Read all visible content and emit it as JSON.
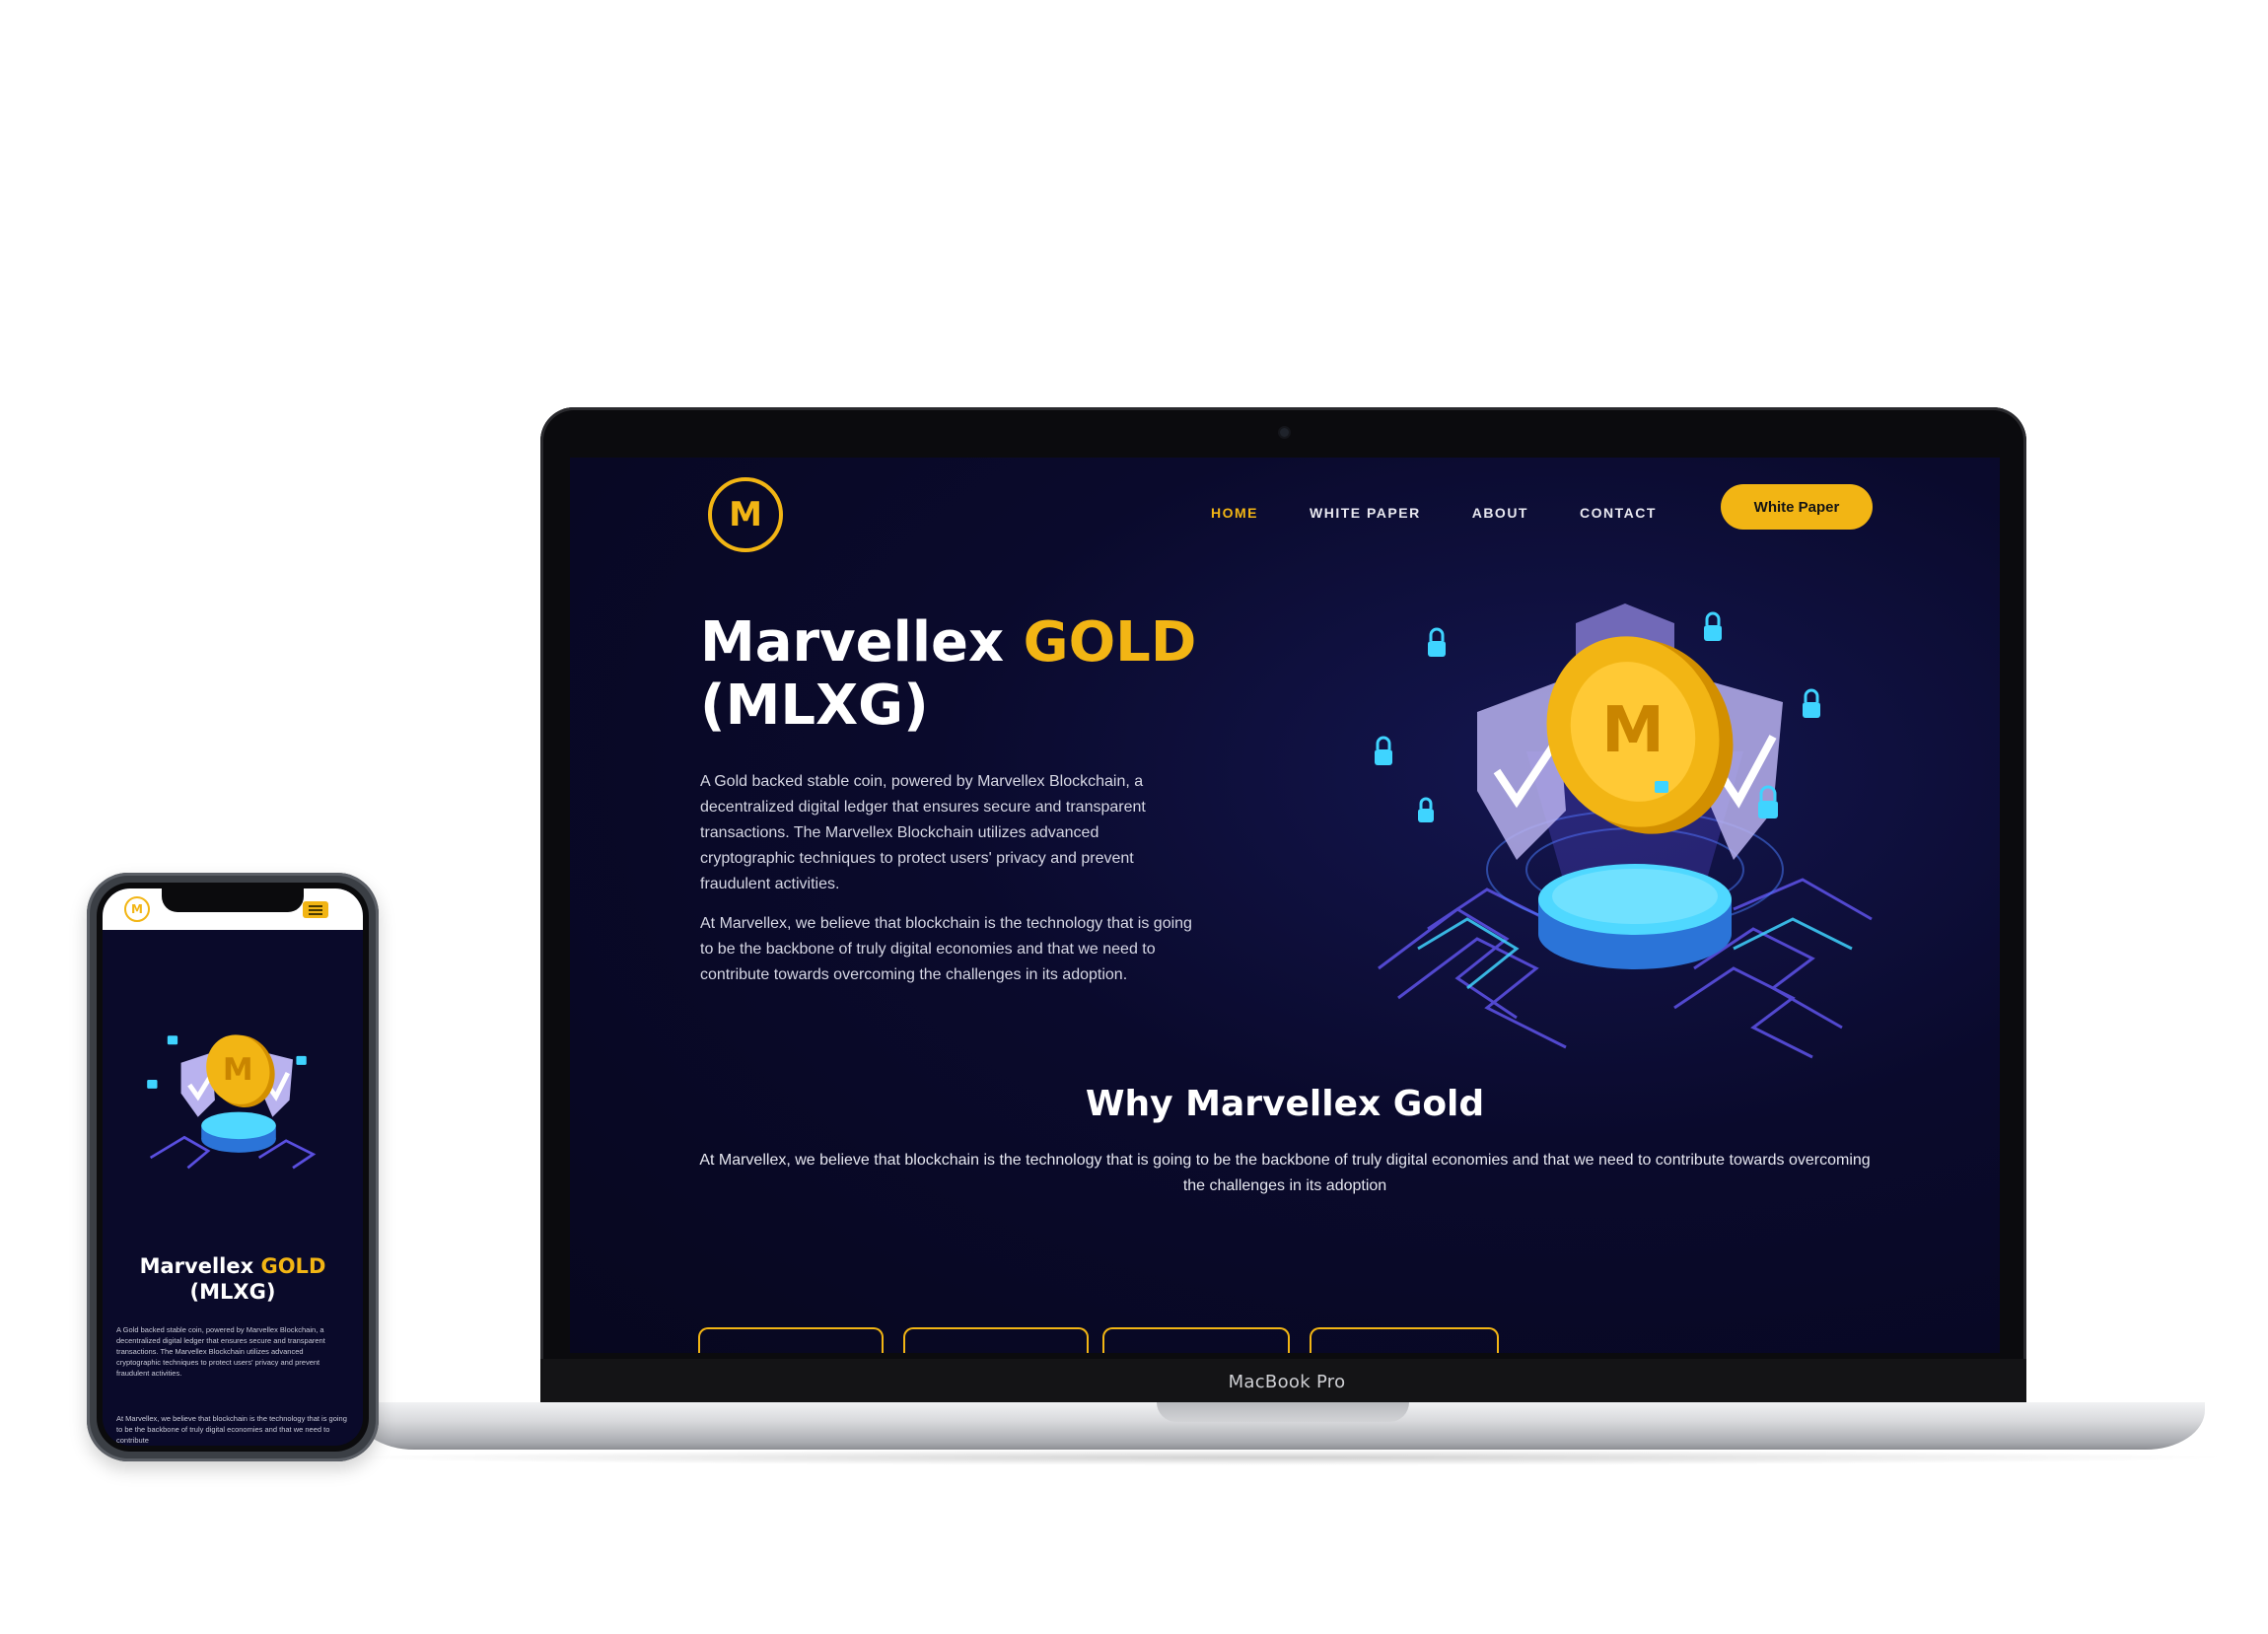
{
  "site": {
    "logo_letter": "M",
    "nav": {
      "home": "HOME",
      "white_paper": "WHITE PAPER",
      "about": "ABOUT",
      "contact": "CONTACT"
    },
    "cta_button": "White Paper",
    "hero": {
      "title_part1": "Marvellex ",
      "title_gold": "GOLD",
      "title_part2": "(MLXG)",
      "paragraph1": "A Gold backed stable coin, powered by Marvellex Blockchain, a decentralized digital ledger that ensures secure and transparent transactions. The Marvellex Blockchain utilizes advanced cryptographic techniques to protect users' privacy and prevent fraudulent activities.",
      "paragraph2": "At Marvellex, we believe that blockchain is the technology that is going to be the backbone of truly digital economies and that we need to contribute towards overcoming the challenges in its adoption."
    },
    "why": {
      "title": "Why Marvellex Gold",
      "text": "At Marvellex, we believe that blockchain is the technology that is going to be the backbone of truly digital economies and that we need to contribute towards overcoming the challenges in its adoption"
    }
  },
  "laptop": {
    "label": "MacBook Pro"
  },
  "phone": {
    "title_part1": "Marvellex ",
    "title_gold": "GOLD",
    "title_part2": "(MLXG)",
    "paragraph1": "A Gold backed stable coin, powered by Marvellex Blockchain, a decentralized digital ledger that ensures secure and transparent transactions. The Marvellex Blockchain utilizes advanced cryptographic techniques to protect users' privacy and prevent fraudulent activities.",
    "paragraph2": "At Marvellex, we believe that blockchain is the technology that is going to be the backbone of truly digital economies and that we need to contribute"
  },
  "colors": {
    "gold": "#f2b514",
    "navy": "#0a0a2c",
    "cyan": "#3fd4ff",
    "purple": "#8a7fd6"
  },
  "icons": [
    "logo-m-icon",
    "padlock-icon",
    "shield-check-icon",
    "coin-icon",
    "hamburger-menu-icon"
  ]
}
